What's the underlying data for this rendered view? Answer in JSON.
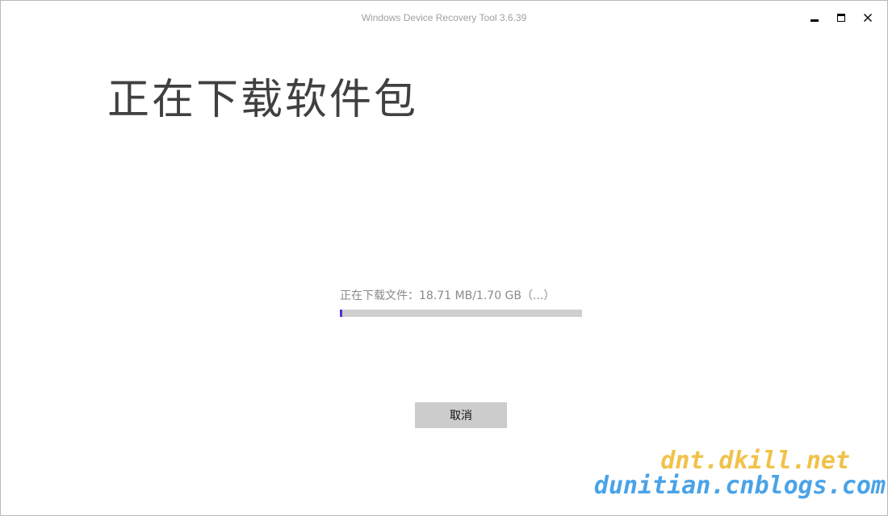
{
  "window": {
    "title": "Windows Device Recovery Tool 3.6.39"
  },
  "main": {
    "heading": "正在下载软件包",
    "status": "正在下载文件：18.71 MB/1.70 GB（...）",
    "progress": 0.011
  },
  "actions": {
    "cancel_label": "取消"
  },
  "watermark": {
    "line1": "dnt.dkill.net",
    "line2": "dunitian.cnblogs.com"
  },
  "colors": {
    "progress_fill": "#5b2bd9",
    "progress_track": "#cfcfcf",
    "cancel_bg": "#cccccc",
    "watermark_yellow": "#f1c24a",
    "watermark_blue": "#4aa3e8"
  }
}
